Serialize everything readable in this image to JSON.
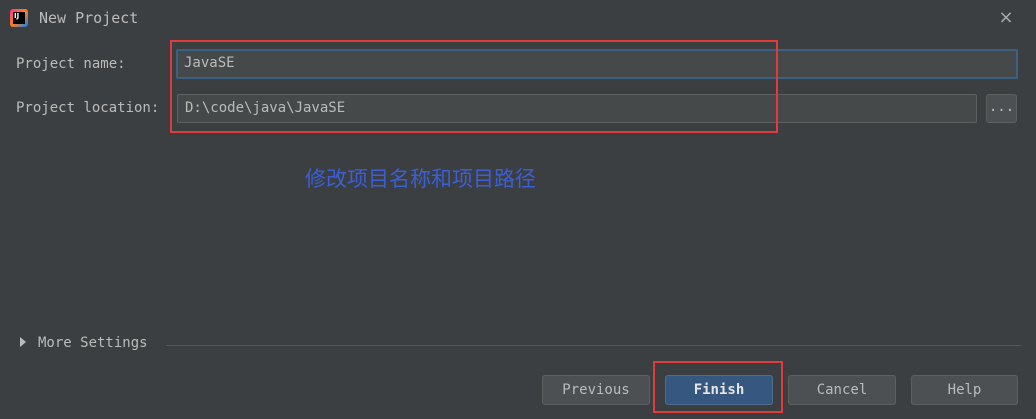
{
  "window": {
    "title": "New Project",
    "icon_text": "IJ",
    "close_icon": "×"
  },
  "form": {
    "name_label": "Project name:",
    "name_value": "JavaSE",
    "location_label": "Project location:",
    "location_value": "D:\\code\\java\\JavaSE",
    "browse_label": "..."
  },
  "annotation": {
    "text": "修改项目名称和项目路径",
    "color": "#3b5fd6"
  },
  "more_settings": {
    "label": "More Settings"
  },
  "buttons": {
    "previous": "Previous",
    "finish": "Finish",
    "cancel": "Cancel",
    "help": "Help"
  },
  "colors": {
    "background": "#3c3f41",
    "highlight_box": "#e03c3c",
    "default_button": "#365880"
  }
}
